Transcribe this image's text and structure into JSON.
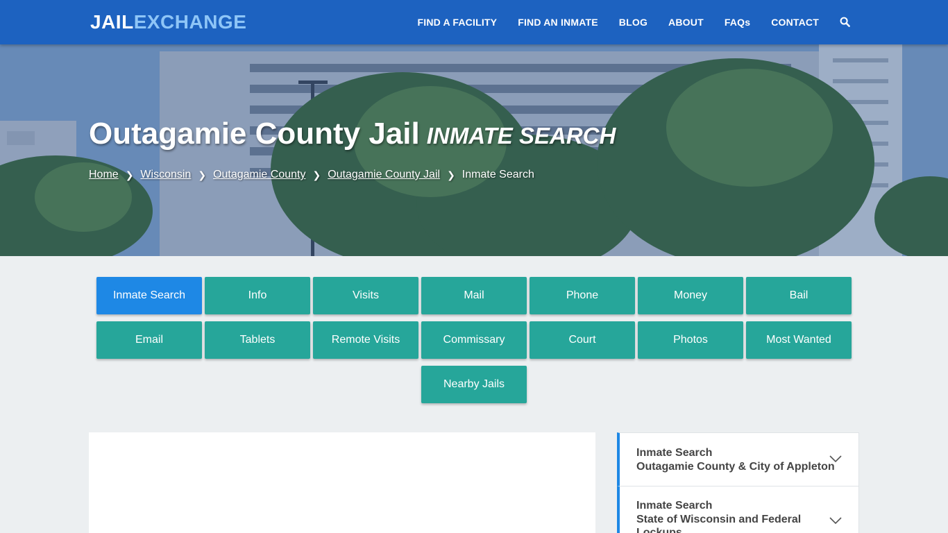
{
  "header": {
    "logo_part1": "JAIL",
    "logo_part2": "EXCHANGE",
    "nav": [
      "FIND A FACILITY",
      "FIND AN INMATE",
      "BLOG",
      "ABOUT",
      "FAQs",
      "CONTACT"
    ],
    "search_icon": "search-icon"
  },
  "hero": {
    "title": "Outagamie County Jail",
    "subtitle": "INMATE SEARCH",
    "breadcrumbs": [
      "Home",
      "Wisconsin",
      "Outagamie County",
      "Outagamie County Jail",
      "Inmate Search"
    ]
  },
  "tabs": {
    "row1": [
      "Inmate Search",
      "Info",
      "Visits",
      "Mail",
      "Phone",
      "Money",
      "Bail"
    ],
    "row2": [
      "Email",
      "Tablets",
      "Remote Visits",
      "Commissary",
      "Court",
      "Photos",
      "Most Wanted"
    ],
    "row3": [
      "Nearby Jails"
    ],
    "active": "Inmate Search"
  },
  "sidebar": {
    "items": [
      {
        "title": "Inmate Search",
        "subtitle": "Outagamie County & City of Appleton"
      },
      {
        "title": "Inmate Search",
        "subtitle": "State of Wisconsin and Federal Lockups"
      }
    ]
  },
  "colors": {
    "header_bg": "#1d62c0",
    "tab_bg": "#26a69a",
    "tab_active": "#1e88e5",
    "page_bg": "#eceff1"
  }
}
